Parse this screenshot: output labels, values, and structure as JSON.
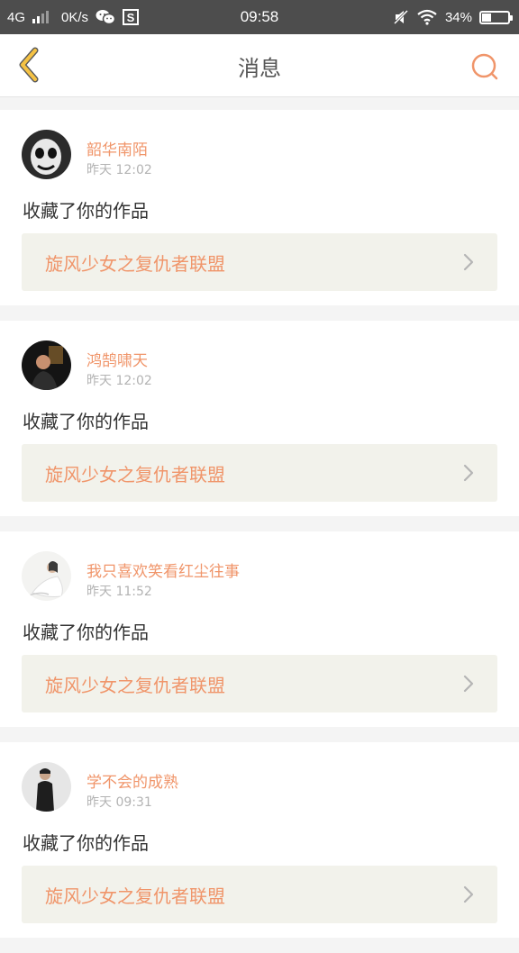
{
  "status_bar": {
    "network": "4G",
    "speed": "0K/s",
    "time": "09:58",
    "battery": "34%",
    "battery_level": 0.34,
    "icons": [
      "signal-icon",
      "wechat-icon",
      "s-app-icon",
      "mute-icon",
      "wifi-icon",
      "battery-icon"
    ]
  },
  "header": {
    "title": "消息",
    "back_icon": "chevron-left-icon",
    "search_icon": "search-icon"
  },
  "colors": {
    "accent": "#f0956a",
    "back_arrow": "#f5c244",
    "status_bar_bg": "#4d4d4d",
    "page_bg": "#f4f4f4",
    "work_bg": "#f2f2eb"
  },
  "messages": [
    {
      "username": "韶华南陌",
      "time": "昨天 12:02",
      "action": "收藏了你的作品",
      "work_title": "旋风少女之复仇者联盟"
    },
    {
      "username": "鸿鹄啸天",
      "time": "昨天 12:02",
      "action": "收藏了你的作品",
      "work_title": "旋风少女之复仇者联盟"
    },
    {
      "username": "我只喜欢笑看红尘往事",
      "time": "昨天 11:52",
      "action": "收藏了你的作品",
      "work_title": "旋风少女之复仇者联盟"
    },
    {
      "username": "学不会的成熟",
      "time": "昨天 09:31",
      "action": "收藏了你的作品",
      "work_title": "旋风少女之复仇者联盟"
    }
  ]
}
